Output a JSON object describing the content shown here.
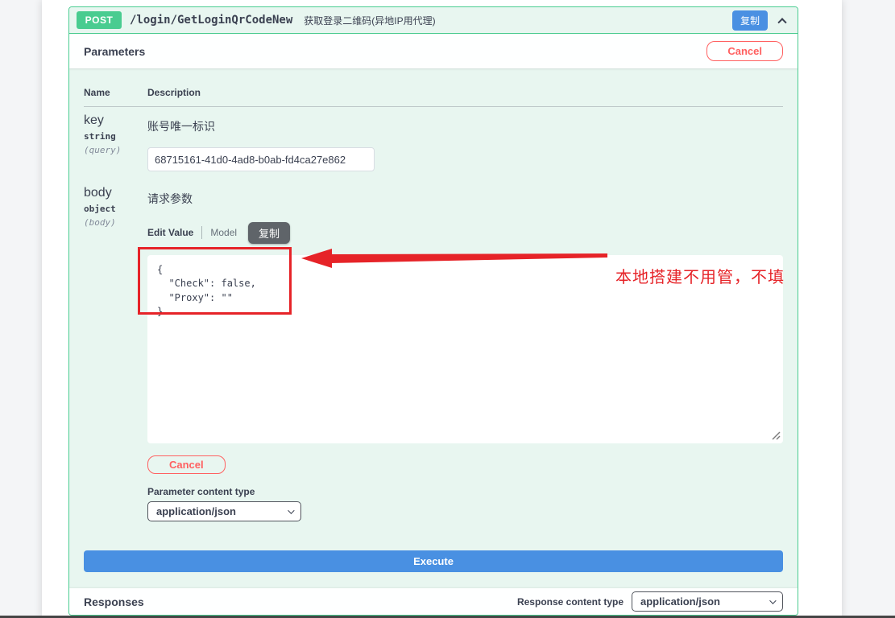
{
  "endpoint": {
    "method": "POST",
    "path": "/login/GetLoginQrCodeNew",
    "summary": "获取登录二维码(异地IP用代理)",
    "copy_label": "复制"
  },
  "parameters": {
    "title": "Parameters",
    "cancel_label": "Cancel",
    "col_name": "Name",
    "col_description": "Description",
    "rows": [
      {
        "name": "key",
        "type": "string",
        "in": "(query)",
        "description": "账号唯一标识",
        "value": "68715161-41d0-4ad8-b0ab-fd4ca27e862"
      },
      {
        "name": "body",
        "type": "object",
        "in": "(body)",
        "description": "请求参数"
      }
    ],
    "body_editor": {
      "tab_edit": "Edit Value",
      "tab_model": "Model",
      "copy_label": "复制",
      "json_value": "{\n  \"Check\": false,\n  \"Proxy\": \"\"\n}",
      "cancel_label": "Cancel",
      "content_type_label": "Parameter content type",
      "content_type_value": "application/json"
    },
    "execute_label": "Execute"
  },
  "annotation": {
    "text": "本地搭建不用管，不填",
    "color": "#e62328"
  },
  "responses": {
    "title": "Responses",
    "content_type_label": "Response content type",
    "content_type_value": "application/json"
  },
  "colors": {
    "method_green": "#49cc90",
    "block_bg": "#e8f6f0",
    "copy_blue": "#4a90e2",
    "execute_blue": "#4990e2",
    "cancel_red": "#ff6060",
    "annotation_red": "#e62328",
    "text_dark": "#3b4151"
  }
}
